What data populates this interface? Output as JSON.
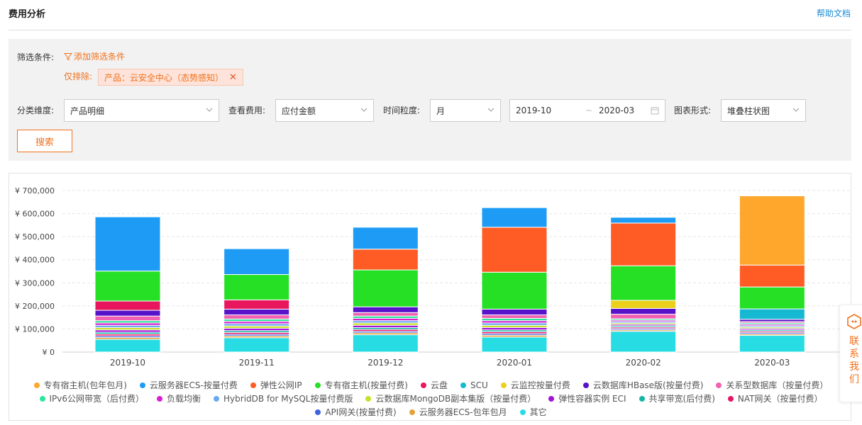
{
  "page": {
    "title": "费用分析",
    "help_link": "帮助文档"
  },
  "filters": {
    "conditions_label": "筛选条件:",
    "add_filter_label": "添加筛选条件",
    "exclude_label": "仅排除:",
    "exclude_tag": "产品：云安全中心（态势感知）",
    "dimension_label": "分类维度:",
    "dimension_value": "产品明细",
    "cost_label": "查看费用:",
    "cost_value": "应付金额",
    "granularity_label": "时间粒度:",
    "granularity_value": "月",
    "date_start": "2019-10",
    "date_end": "2020-03",
    "chart_form_label": "图表形式:",
    "chart_form_value": "堆叠柱状图",
    "search_button": "搜索"
  },
  "contact_tab": {
    "label": "联系我们"
  },
  "chart_data": {
    "type": "bar",
    "stacked": true,
    "categories": [
      "2019-10",
      "2019-11",
      "2019-12",
      "2020-01",
      "2020-02",
      "2020-03"
    ],
    "ylim": [
      0,
      700000
    ],
    "yticks": [
      "¥ 0",
      "¥ 100,000",
      "¥ 200,000",
      "¥ 300,000",
      "¥ 400,000",
      "¥ 500,000",
      "¥ 600,000",
      "¥ 700,000"
    ],
    "grid": true,
    "legend_position": "bottom",
    "series": [
      {
        "name": "其它",
        "color": "#28dce3",
        "values": [
          55000,
          62000,
          75000,
          65000,
          90000,
          72000
        ]
      },
      {
        "name": "云服务器ECS-包年包月",
        "color": "#e3a33a",
        "values": [
          8000,
          8000,
          8000,
          8000,
          6000,
          6000
        ]
      },
      {
        "name": "API网关(按量付费)",
        "color": "#3c63dd",
        "values": [
          7000,
          7000,
          7000,
          7000,
          6000,
          6000
        ]
      },
      {
        "name": "NAT网关（按量付费）",
        "color": "#e5156a",
        "values": [
          8000,
          8000,
          8000,
          8000,
          6000,
          6000
        ]
      },
      {
        "name": "共享带宽(后付费)",
        "color": "#12b5a4",
        "values": [
          8000,
          8000,
          8000,
          8000,
          6000,
          6000
        ]
      },
      {
        "name": "弹性容器实例 ECI",
        "color": "#a013d8",
        "values": [
          10000,
          10000,
          10000,
          10000,
          6000,
          6000
        ]
      },
      {
        "name": "云数据库MongoDB副本集版（按量付费）",
        "color": "#c7e02a",
        "values": [
          10000,
          10000,
          10000,
          10000,
          6000,
          6000
        ]
      },
      {
        "name": "HybridDB for MySQL按量付费版",
        "color": "#6aa8f0",
        "values": [
          10000,
          10000,
          10000,
          10000,
          6000,
          6000
        ]
      },
      {
        "name": "负载均衡",
        "color": "#d81fd3",
        "values": [
          10000,
          10000,
          10000,
          10000,
          6000,
          6000
        ]
      },
      {
        "name": "IPv6公网带宽（后付费）",
        "color": "#2de598",
        "values": [
          10000,
          10000,
          10000,
          10000,
          6000,
          6000
        ]
      },
      {
        "name": "关系型数据库（按量付费）",
        "color": "#f061b1",
        "values": [
          20000,
          18000,
          15000,
          15000,
          20000,
          6000
        ]
      },
      {
        "name": "云数据库HBase版(按量付费)",
        "color": "#5613c9",
        "values": [
          25000,
          25000,
          25000,
          25000,
          25000,
          10000
        ]
      },
      {
        "name": "云监控按量付费",
        "color": "#ecd11c",
        "values": [
          0,
          0,
          0,
          0,
          35000,
          0
        ]
      },
      {
        "name": "SCU",
        "color": "#17b9d2",
        "values": [
          0,
          0,
          0,
          0,
          0,
          45000
        ]
      },
      {
        "name": "云盘",
        "color": "#e8175d",
        "values": [
          40000,
          40000,
          0,
          0,
          0,
          0
        ]
      },
      {
        "name": "专有宿主机(按量付费)",
        "color": "#25e025",
        "values": [
          130000,
          110000,
          160000,
          160000,
          150000,
          95000
        ]
      },
      {
        "name": "弹性公网IP",
        "color": "#ff5c25",
        "values": [
          0,
          0,
          90000,
          195000,
          185000,
          95000
        ]
      },
      {
        "name": "云服务器ECS-按量付费",
        "color": "#1e9cf5",
        "values": [
          235000,
          112000,
          95000,
          85000,
          25000,
          0
        ]
      },
      {
        "name": "专有宿主机(包年包月)",
        "color": "#fea72c",
        "values": [
          0,
          0,
          0,
          0,
          0,
          300000
        ]
      }
    ],
    "legend_order": [
      "专有宿主机(包年包月)",
      "云服务器ECS-按量付费",
      "弹性公网IP",
      "专有宿主机(按量付费)",
      "云盘",
      "SCU",
      "云监控按量付费",
      "云数据库HBase版(按量付费)",
      "关系型数据库（按量付费）",
      "IPv6公网带宽（后付费）",
      "负载均衡",
      "HybridDB for MySQL按量付费版",
      "云数据库MongoDB副本集版（按量付费）",
      "弹性容器实例 ECI",
      "共享带宽(后付费)",
      "NAT网关（按量付费）",
      "API网关(按量付费)",
      "云服务器ECS-包年包月",
      "其它"
    ]
  }
}
